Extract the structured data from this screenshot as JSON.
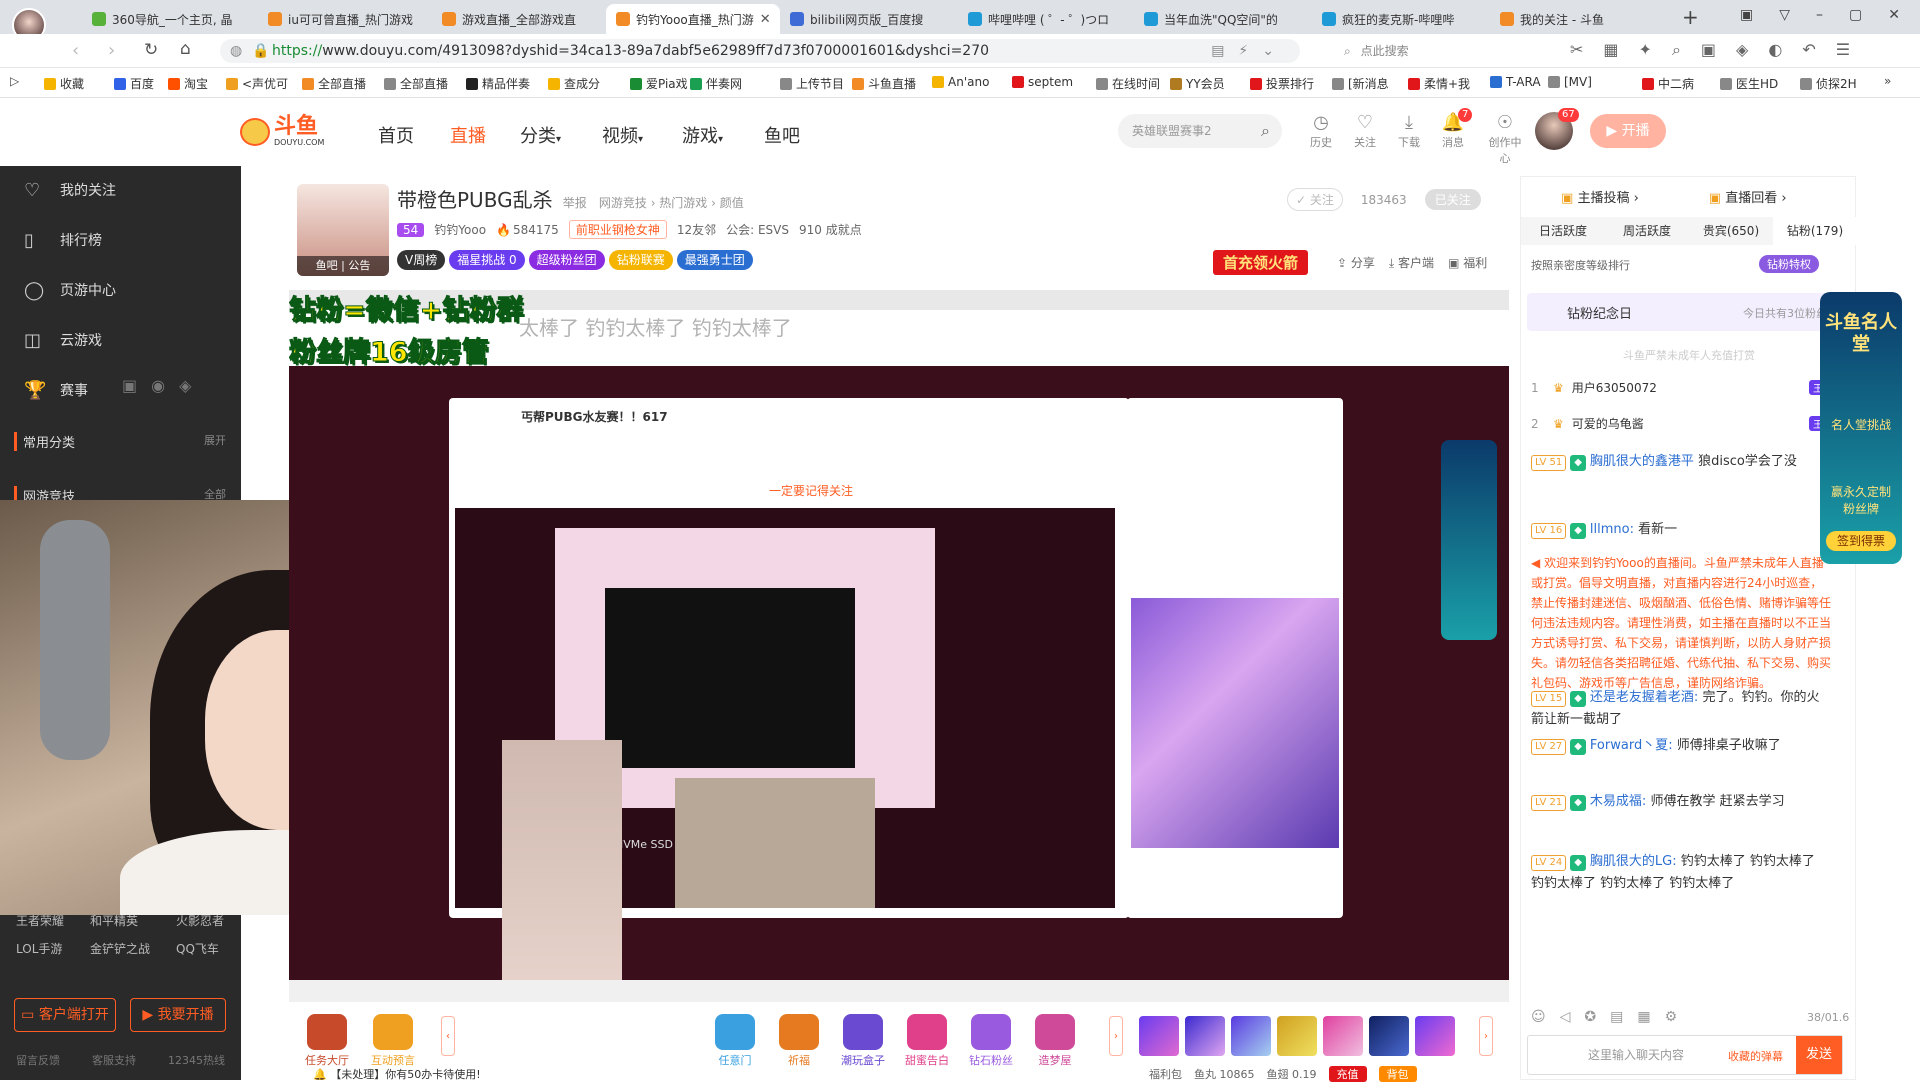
{
  "browser": {
    "tabs": [
      {
        "title": "360导航_一个主页, 晶",
        "color": "#58b23a"
      },
      {
        "title": "iu可可曾直播_热门游戏",
        "color": "#f28b25"
      },
      {
        "title": "游戏直播_全部游戏直",
        "color": "#f28b25"
      },
      {
        "title": "钓钓Yooo直播_热门游",
        "color": "#f28b25"
      },
      {
        "title": "bilibili网页版_百度搜",
        "color": "#3e6bd6"
      },
      {
        "title": "哔哩哔哩 ( ゜- ゜)つロ",
        "color": "#1e9ad6"
      },
      {
        "title": "当年血洗\"QQ空间\"的",
        "color": "#1e9ad6"
      },
      {
        "title": "疯狂的麦克斯-哔哩哔",
        "color": "#1e9ad6"
      },
      {
        "title": "我的关注 - 斗鱼",
        "color": "#f28b25"
      }
    ],
    "url_scheme": "https://",
    "url_rest": "www.douyu.com/4913098?dyshid=34ca13-89a7dabf5e62989ff7d73f0700001601&dyshci=270",
    "search_placeholder": "点此搜索",
    "bookmarks": [
      "收藏",
      "百度",
      "淘宝",
      "<声优可",
      "全部直播",
      "全部直播",
      "精品伴奏",
      "查成分",
      "爱Pia戏",
      "伴奏网",
      "上传节目",
      "斗鱼直播",
      "An'ano",
      "septem",
      "在线时间",
      "YY会员",
      "投票排行",
      "[新消息",
      "柔情+我",
      "T-ARA",
      "[MV]",
      "中二病",
      "医生HD",
      "侦探2H"
    ]
  },
  "douyu": {
    "logo": "斗鱼",
    "logo_sub": "DOUYU.COM",
    "nav": [
      "首页",
      "直播",
      "分类",
      "视频",
      "游戏",
      "鱼吧"
    ],
    "search_placeholder": "英雄联盟赛事2",
    "header_icons": [
      {
        "name": "history",
        "label": "历史",
        "glyph": "◷"
      },
      {
        "name": "follow",
        "label": "关注",
        "glyph": "♡"
      },
      {
        "name": "download",
        "label": "下载",
        "glyph": "⤓"
      },
      {
        "name": "message",
        "label": "消息",
        "glyph": "🔔"
      },
      {
        "name": "creator",
        "label": "创作中心",
        "glyph": "☉"
      }
    ],
    "message_count": "7",
    "avatar_badge": "67",
    "start_button": "开播"
  },
  "sidebar": {
    "items": [
      {
        "label": "我的关注",
        "glyph": "♡"
      },
      {
        "label": "排行榜",
        "glyph": "▯"
      },
      {
        "label": "页游中心",
        "glyph": "◯"
      },
      {
        "label": "云游戏",
        "glyph": "◫"
      },
      {
        "label": "赛事",
        "glyph": "🏆"
      }
    ],
    "section_label": "常用分类",
    "section_action": "展开",
    "sub_label": "网游竞技",
    "sub_action": "全部",
    "games_row1": [
      "王者荣耀",
      "和平精英",
      "火影忍者"
    ],
    "games_row2": [
      "LOL手游",
      "金铲铲之战",
      "QQ飞车"
    ],
    "client_button": "客户端打开",
    "broadcast_button": "我要开播",
    "footer": [
      "留言反馈",
      "客服支持",
      "12345热线"
    ]
  },
  "room": {
    "title": "带橙色PUBG乱杀",
    "report": "举报",
    "breadcrumb": "网游竞技 › 热门游戏 › 颜值",
    "level": "54",
    "streamer": "钓钓Yooo",
    "hot": "584175",
    "tag": "前职业钢枪女神",
    "fans": "12友邻",
    "guild": "公会: ESVS",
    "achievements": "910 成就点",
    "avatar_label": "鱼吧 | 公告",
    "follow_state": "已关注",
    "follow_count": "183463",
    "unfollow_btn": "✓ 关注",
    "badges": [
      {
        "label": "V周榜",
        "color": "#333"
      },
      {
        "label": "福星挑战 0",
        "color": "#6a3cf0"
      },
      {
        "label": "超级粉丝团",
        "color": "#8b2be2"
      },
      {
        "label": "钻粉联赛",
        "color": "#f5b400"
      },
      {
        "label": "最强勇士团",
        "color": "#2b6ed1"
      }
    ],
    "recharge_btn": "首充领火箭",
    "share": "分享",
    "client": "客户端",
    "welfare": "福利"
  },
  "video": {
    "overlay_line1": "钻粉=微信+钻粉群",
    "overlay_line2": "粉丝牌16级房管",
    "danmaku": "太棒了 钓钓太棒了 钓钓太棒了",
    "inner_title": "丐帮PUBG水友赛！！617",
    "inner_notice": "一定要记得关注",
    "nvme": "NVMe SSD"
  },
  "gifts": [
    {
      "label": "任务大厅",
      "color": "#c74a2a"
    },
    {
      "label": "互动预言",
      "color": "#f0a020"
    },
    {
      "label": "任意门",
      "color": "#3aa0e0"
    },
    {
      "label": "祈福",
      "color": "#e57a20"
    },
    {
      "label": "潮玩盒子",
      "color": "#6a4ad0"
    },
    {
      "label": "甜蜜告白",
      "color": "#e0408a"
    },
    {
      "label": "钻石粉丝",
      "color": "#9a5ae0"
    },
    {
      "label": "造梦屋",
      "color": "#d04a9a"
    }
  ],
  "gift_notice": "【未处理】你有50办卡待使用!",
  "bottom_stats": {
    "welfare": "福利包",
    "yuwan": "鱼丸 10865",
    "yuchi": "鱼翅 0.19",
    "recharge": "充值",
    "backpack": "背包"
  },
  "chat": {
    "vote": "主播投稿",
    "replay": "直播回看",
    "tabs": [
      "日活跃度",
      "周活跃度",
      "贵宾(650)",
      "钻粉(179)"
    ],
    "sort_label": "按照亲密度等级排行",
    "diamond_btn": "钻粉特权",
    "day_title": "钻粉纪念日",
    "day_desc": "今日共有3位粉丝",
    "minor_notice": "斗鱼严禁未成年人充值打赏",
    "rank": [
      {
        "pos": "1",
        "name": "用户63050072",
        "badge": "王豹约"
      },
      {
        "pos": "2",
        "name": "可爱的乌龟酱",
        "badge": "王豹约"
      }
    ],
    "messages": [
      {
        "lv": "LV 51",
        "user": "胸肌很大的鑫港平",
        "text": "狼disco学会了没"
      },
      {
        "lv": "LV 16",
        "user": "lllmno:",
        "text": "看新一"
      },
      {
        "lv": "",
        "user": "",
        "text": "欢迎来到钓钓Yooo的直播间。斗鱼严禁未成年人直播或打赏。倡导文明直播，对直播内容进行24小时巡查，禁止传播封建迷信、吸烟酗酒、低俗色情、赌博诈骗等任何违法违规内容。请理性消费，如主播在直播时以不正当方式诱导打赏、私下交易，请谨慎判断，以防人身财产损失。请勿轻信各类招聘征婚、代练代抽、私下交易、购买礼包码、游戏币等广告信息，谨防网络诈骗。"
      },
      {
        "lv": "LV 15",
        "user": "还是老友握着老酒:",
        "text": "完了。钓钓。你的火箭让新一截胡了"
      },
      {
        "lv": "LV 27",
        "user": "Forward丶夏:",
        "text": "师傅排桌子收嘛了"
      },
      {
        "lv": "LV 21",
        "user": "木易成福:",
        "text": "师傅在教学 赶紧去学习"
      },
      {
        "lv": "LV 24",
        "user": "胸肌很大的LG:",
        "text": "钓钓太棒了 钓钓太棒了 钓钓太棒了 钓钓太棒了 钓钓太棒了"
      }
    ],
    "input_placeholder": "这里输入聊天内容",
    "send": "发送",
    "side_btn": "收藏的弹幕",
    "counter": "38/01.6"
  },
  "promo": {
    "title": "斗鱼名人堂",
    "sub": "名人堂挑战",
    "line": "赢永久定制粉丝牌",
    "cta": "签到得票"
  }
}
